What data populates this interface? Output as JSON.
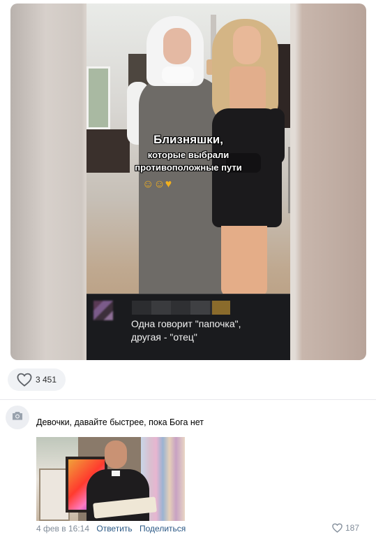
{
  "post": {
    "video_overlay": {
      "line1": "Близняшки,",
      "line2": "которые выбрали",
      "line3": "противоположные пути"
    },
    "embedded_comment": {
      "text_line1": "Одна говорит \"папочка\",",
      "text_line2": "другая - \"отец\""
    },
    "likes": {
      "count": "3 451",
      "icon": "heart-icon"
    }
  },
  "comment": {
    "avatar_icon": "camera-icon",
    "text": "Девочки, давайте быстрее, пока Бога нет",
    "date": "4 фев в 16:14",
    "reply_label": "Ответить",
    "share_label": "Поделиться",
    "likes_count": "187",
    "like_icon": "heart-icon"
  },
  "colors": {
    "link": "#2a5885",
    "meta": "#818c99",
    "pill_bg": "#f0f2f5",
    "comment_panel_bg": "#1a1b1e"
  }
}
